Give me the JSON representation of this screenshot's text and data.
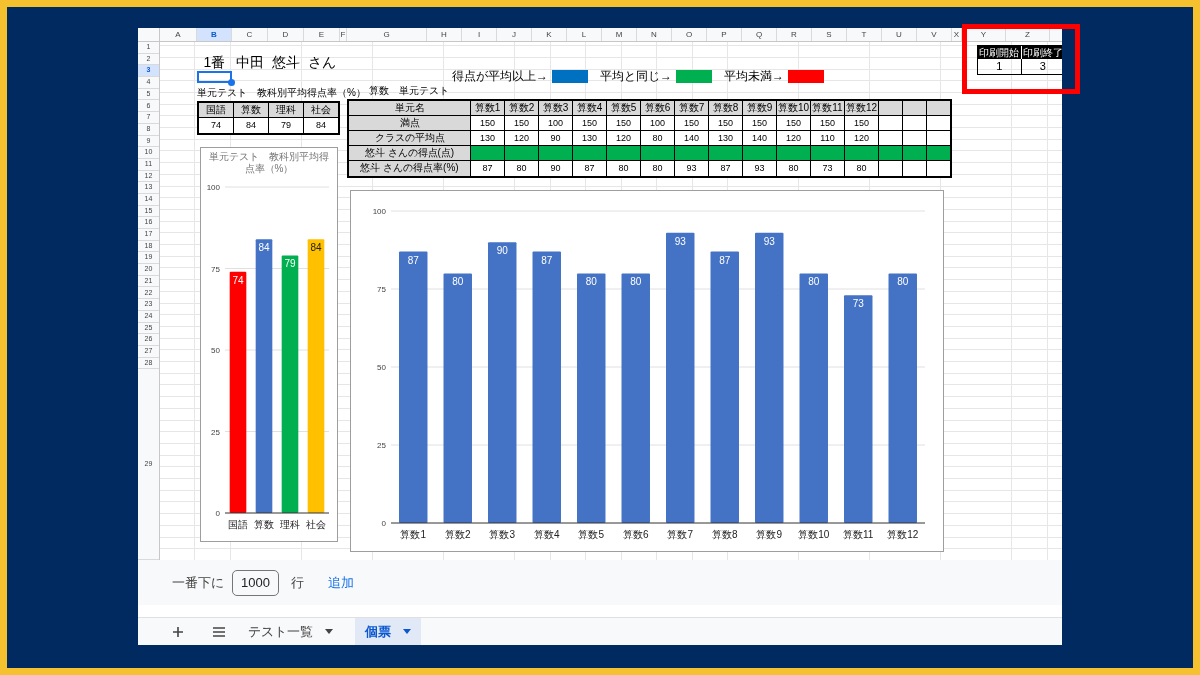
{
  "columns": [
    {
      "label": "A",
      "selected": false
    },
    {
      "label": "B",
      "selected": true
    },
    {
      "label": "C",
      "selected": false
    },
    {
      "label": "D",
      "selected": false
    },
    {
      "label": "E",
      "selected": false
    },
    {
      "label": "F",
      "selected": false
    },
    {
      "label": "G",
      "selected": false
    },
    {
      "label": "H",
      "selected": false
    },
    {
      "label": "I",
      "selected": false
    },
    {
      "label": "J",
      "selected": false
    },
    {
      "label": "K",
      "selected": false
    },
    {
      "label": "L",
      "selected": false
    },
    {
      "label": "M",
      "selected": false
    },
    {
      "label": "N",
      "selected": false
    },
    {
      "label": "O",
      "selected": false
    },
    {
      "label": "P",
      "selected": false
    },
    {
      "label": "Q",
      "selected": false
    },
    {
      "label": "R",
      "selected": false
    },
    {
      "label": "S",
      "selected": false
    },
    {
      "label": "T",
      "selected": false
    },
    {
      "label": "U",
      "selected": false
    },
    {
      "label": "V",
      "selected": false
    },
    {
      "label": "X",
      "selected": false
    },
    {
      "label": "Y",
      "selected": false
    },
    {
      "label": "Z",
      "selected": false
    }
  ],
  "rows": [
    {
      "label": "1",
      "selected": false
    },
    {
      "label": "2",
      "selected": false
    },
    {
      "label": "3",
      "selected": true
    },
    {
      "label": "4",
      "selected": false
    },
    {
      "label": "5",
      "selected": false
    },
    {
      "label": "6",
      "selected": false
    },
    {
      "label": "7",
      "selected": false
    },
    {
      "label": "8",
      "selected": false
    },
    {
      "label": "9",
      "selected": false
    },
    {
      "label": "10",
      "selected": false
    },
    {
      "label": "11",
      "selected": false
    },
    {
      "label": "12",
      "selected": false
    },
    {
      "label": "13",
      "selected": false
    },
    {
      "label": "14",
      "selected": false
    },
    {
      "label": "15",
      "selected": false
    },
    {
      "label": "16",
      "selected": false
    },
    {
      "label": "17",
      "selected": false
    },
    {
      "label": "18",
      "selected": false
    },
    {
      "label": "19",
      "selected": false
    },
    {
      "label": "20",
      "selected": false
    },
    {
      "label": "21",
      "selected": false
    },
    {
      "label": "22",
      "selected": false
    },
    {
      "label": "23",
      "selected": false
    },
    {
      "label": "24",
      "selected": false
    },
    {
      "label": "25",
      "selected": false
    },
    {
      "label": "26",
      "selected": false
    },
    {
      "label": "27",
      "selected": false
    },
    {
      "label": "28",
      "selected": false
    },
    {
      "label": "29",
      "selected": false
    }
  ],
  "title_cells": [
    "1番",
    "中田",
    "悠斗",
    "さん"
  ],
  "legend": [
    {
      "label": "得点が平均以上→",
      "color": "#0070c0"
    },
    {
      "label": "平均と同じ→",
      "color": "#00b050"
    },
    {
      "label": "平均未満→",
      "color": "#ff0000"
    }
  ],
  "subject_table": {
    "caption": "単元テスト　教科別平均得点率（%）",
    "headers": [
      "国語",
      "算数",
      "理科",
      "社会"
    ],
    "values": [
      "74",
      "84",
      "79",
      "84"
    ]
  },
  "unit_table": {
    "caption": "算数　単元テスト",
    "rows": [
      {
        "kind": "header",
        "label": "単元名",
        "cells": [
          "算数1",
          "算数2",
          "算数3",
          "算数4",
          "算数5",
          "算数6",
          "算数7",
          "算数8",
          "算数9",
          "算数10",
          "算数11",
          "算数12"
        ]
      },
      {
        "kind": "data",
        "label": "満点",
        "cells": [
          "150",
          "150",
          "100",
          "150",
          "150",
          "100",
          "150",
          "150",
          "150",
          "150",
          "150",
          "150"
        ]
      },
      {
        "kind": "data",
        "label": "クラスの平均点",
        "cells": [
          "130",
          "120",
          "90",
          "130",
          "120",
          "80",
          "140",
          "130",
          "140",
          "120",
          "110",
          "120"
        ]
      },
      {
        "kind": "fill",
        "label": "悠斗 さんの得点(点)",
        "color": "#00b050"
      },
      {
        "kind": "data",
        "label": "悠斗 さんの得点率(%)",
        "cells": [
          "87",
          "80",
          "90",
          "87",
          "80",
          "80",
          "93",
          "87",
          "93",
          "80",
          "73",
          "80"
        ]
      }
    ]
  },
  "print_range": {
    "headers": [
      "印刷開始",
      "印刷終了"
    ],
    "values": [
      "1",
      "3"
    ]
  },
  "subject_chart": {
    "chart_data": {
      "type": "bar",
      "title": "単元テスト　教科別平均得点率（%）",
      "categories": [
        "国語",
        "算数",
        "理科",
        "社会"
      ],
      "series": [
        {
          "color": "#ff0000",
          "values": [
            74,
            null,
            null,
            null
          ]
        },
        {
          "color": "#4472c4",
          "values": [
            null,
            84,
            null,
            null
          ]
        },
        {
          "color": "#00b050",
          "values": [
            null,
            null,
            79,
            null
          ]
        },
        {
          "color": "#ffc000",
          "values": [
            null,
            null,
            null,
            84
          ]
        }
      ],
      "stacked": true,
      "grid": true,
      "ylim": [
        0,
        100
      ],
      "yticks": [
        0,
        25,
        50,
        75,
        100
      ],
      "data_labels": true
    }
  },
  "unit_chart": {
    "chart_data": {
      "type": "bar",
      "categories": [
        "算数1",
        "算数2",
        "算数3",
        "算数4",
        "算数5",
        "算数6",
        "算数7",
        "算数8",
        "算数9",
        "算数10",
        "算数11",
        "算数12"
      ],
      "series": [
        {
          "color": "#4472c4",
          "values": [
            87,
            80,
            90,
            87,
            80,
            80,
            93,
            87,
            93,
            80,
            73,
            80
          ]
        }
      ],
      "grid": true,
      "ylim": [
        0,
        100
      ],
      "yticks": [
        0,
        25,
        50,
        75,
        100
      ],
      "data_labels": true
    }
  },
  "add_rows": {
    "prefix": "一番下に",
    "value": "1000",
    "suffix": "行",
    "button": "追加"
  },
  "sheet_tabs": [
    {
      "label": "テスト一覧",
      "selected": false
    },
    {
      "label": "個票",
      "selected": true
    }
  ]
}
